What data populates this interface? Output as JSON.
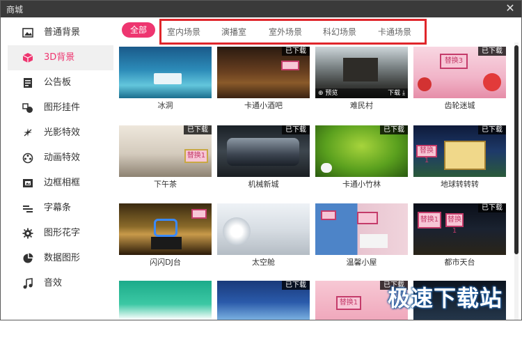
{
  "window": {
    "title": "商城",
    "close_glyph": "✕"
  },
  "sidebar": {
    "items": [
      {
        "label": "普通背景",
        "icon": "image-icon",
        "active": false
      },
      {
        "label": "3D背景",
        "icon": "cube-icon",
        "active": true
      },
      {
        "label": "公告板",
        "icon": "board-icon",
        "active": false
      },
      {
        "label": "图形挂件",
        "icon": "shapes-icon",
        "active": false
      },
      {
        "label": "光影特效",
        "icon": "sparkle-icon",
        "active": false
      },
      {
        "label": "动画特效",
        "icon": "film-reel-icon",
        "active": false
      },
      {
        "label": "边框相框",
        "icon": "frame-icon",
        "active": false
      },
      {
        "label": "字幕条",
        "icon": "subtitle-icon",
        "active": false
      },
      {
        "label": "图形花字",
        "icon": "gear-text-icon",
        "active": false
      },
      {
        "label": "数据图形",
        "icon": "pie-chart-icon",
        "active": false
      },
      {
        "label": "音效",
        "icon": "music-note-icon",
        "active": false
      }
    ]
  },
  "filters": {
    "all_label": "全部",
    "tabs": [
      "室内场景",
      "演播室",
      "室外场景",
      "科幻场景",
      "卡通场景"
    ]
  },
  "grid": {
    "downloaded_badge": "已下载",
    "preview_label": "预览",
    "download_label": "下载",
    "items": [
      {
        "caption": "冰洞",
        "downloaded": false
      },
      {
        "caption": "卡通小酒吧",
        "downloaded": true
      },
      {
        "caption": "难民村",
        "downloaded": false,
        "hovered": true
      },
      {
        "caption": "齿轮迷城",
        "downloaded": true
      },
      {
        "caption": "下午茶",
        "downloaded": true
      },
      {
        "caption": "机械新城",
        "downloaded": true
      },
      {
        "caption": "卡通小竹林",
        "downloaded": true
      },
      {
        "caption": "地球转转转",
        "downloaded": true
      },
      {
        "caption": "闪闪DJ台",
        "downloaded": false
      },
      {
        "caption": "太空舱",
        "downloaded": false
      },
      {
        "caption": "温馨小屋",
        "downloaded": false
      },
      {
        "caption": "都市天台",
        "downloaded": true
      },
      {
        "caption": "",
        "downloaded": false
      },
      {
        "caption": "",
        "downloaded": true
      },
      {
        "caption": "",
        "downloaded": true
      },
      {
        "caption": "",
        "downloaded": false
      }
    ],
    "sign_texts": [
      "替换3",
      "替换1",
      "替换1",
      "替换1",
      "替换1",
      "替换1"
    ]
  },
  "watermark": "极速下载站",
  "colors": {
    "accent": "#ee3670",
    "highlight_box": "#e0262b",
    "titlebar": "#3a3a3a"
  }
}
